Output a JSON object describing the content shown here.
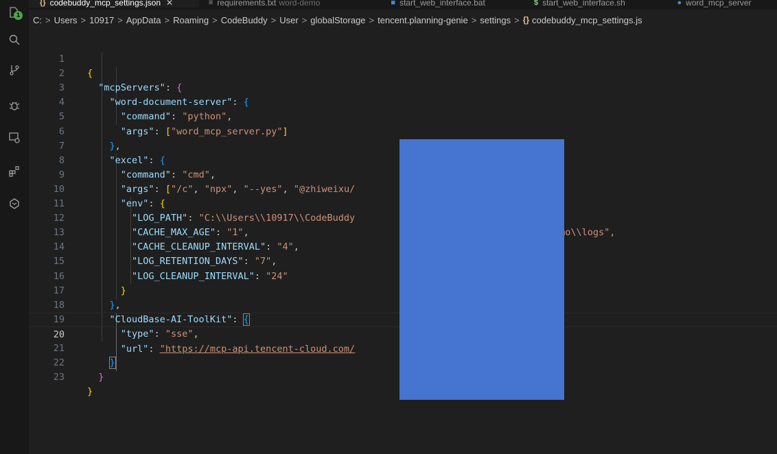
{
  "tabs": [
    {
      "icon": "{}",
      "label": "codebuddy_mcp_settings.json",
      "close": "✕",
      "active": true
    },
    {
      "icon": "≡",
      "label": "requirements.txt",
      "suffix": "word-demo"
    },
    {
      "icon": "■",
      "label": "start_web_interface.bat"
    },
    {
      "icon": "$",
      "label": "start_web_interface.sh"
    },
    {
      "icon": "●",
      "label": "word_mcp_server"
    }
  ],
  "activity": {
    "badge": "1"
  },
  "breadcrumb": {
    "parts": [
      "C:",
      "Users",
      "10917",
      "AppData",
      "Roaming",
      "CodeBuddy",
      "User",
      "globalStorage",
      "tencent.planning-genie",
      "settings"
    ],
    "file_icon": "{}",
    "file": "codebuddy_mcp_settings.js",
    "sep": ">"
  },
  "code": {
    "current_line": "20",
    "lines": [
      {
        "n": "1"
      },
      {
        "n": "2"
      },
      {
        "n": "3"
      },
      {
        "n": "4"
      },
      {
        "n": "5"
      },
      {
        "n": "6"
      },
      {
        "n": "7"
      },
      {
        "n": "8"
      },
      {
        "n": "9"
      },
      {
        "n": "10"
      },
      {
        "n": "11"
      },
      {
        "n": "12"
      },
      {
        "n": "13"
      },
      {
        "n": "14"
      },
      {
        "n": "15"
      },
      {
        "n": "16"
      },
      {
        "n": "17"
      },
      {
        "n": "18"
      },
      {
        "n": "19"
      },
      {
        "n": "20"
      },
      {
        "n": "21"
      },
      {
        "n": "22"
      },
      {
        "n": "23"
      }
    ],
    "keys": {
      "mcpServers": "\"mcpServers\"",
      "word": "\"word-document-server\"",
      "command": "\"command\"",
      "args": "\"args\"",
      "excel": "\"excel\"",
      "env": "\"env\"",
      "log_path": "\"LOG_PATH\"",
      "cache_max_age": "\"CACHE_MAX_AGE\"",
      "cache_cleanup": "\"CACHE_CLEANUP_INTERVAL\"",
      "log_retention": "\"LOG_RETENTION_DAYS\"",
      "log_cleanup": "\"LOG_CLEANUP_INTERVAL\"",
      "cloudbase": "\"CloudBase-AI-ToolKit\"",
      "type": "\"type\"",
      "url": "\"url\""
    },
    "values": {
      "python": "\"python\"",
      "word_script": "\"word_mcp_server.py\"",
      "cmd": "\"cmd\"",
      "arg_c": "\"/c\"",
      "arg_npx": "\"npx\"",
      "arg_yes": "\"--yes\"",
      "arg_pkg": "\"@zhiweixu/",
      "log_path_left": "\"C:\\\\Users\\\\10917\\\\CodeBuddy",
      "log_path_right": "emo\\\\logs\",",
      "cache_max_age": "\"1\"",
      "cache_cleanup": "\"4\"",
      "log_retention": "\"7\"",
      "log_cleanup": "\"24\"",
      "sse": "\"sse\"",
      "url_left": "\"https://mcp-api.tencent-cloud.com/"
    }
  }
}
